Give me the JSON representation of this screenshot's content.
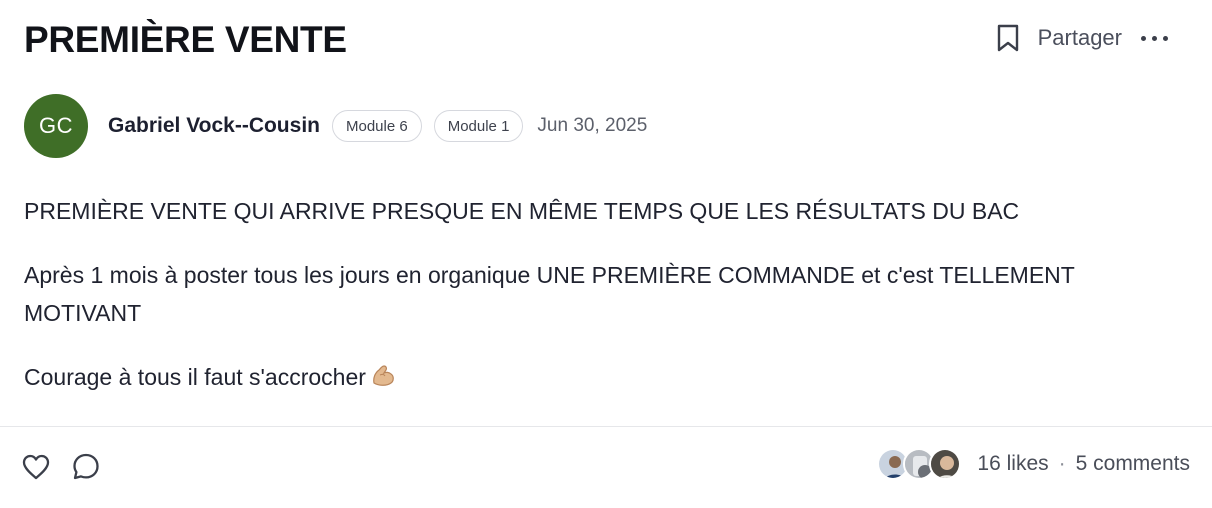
{
  "post": {
    "title": "PREMIÈRE VENTE",
    "share_label": "Partager",
    "author": {
      "initials": "GC",
      "name": "Gabriel Vock--Cousin",
      "avatar_color": "#3f6e27"
    },
    "tags": [
      "Module 6",
      "Module 1"
    ],
    "date": "Jun 30, 2025",
    "paragraphs": [
      "PREMIÈRE VENTE QUI ARRIVE PRESQUE EN MÊME TEMPS QUE LES RÉSULTATS DU BAC",
      "Après 1 mois à poster tous les jours en organique UNE PREMIÈRE COMMANDE et c'est TELLEMENT MOTIVANT",
      "Courage à tous il faut s'accrocher"
    ],
    "emoji": "flexed-biceps-icon",
    "likes_text": "16 likes",
    "separator": "·",
    "comments_text": "5 comments"
  },
  "icons": {
    "bookmark": "bookmark-icon",
    "more": "more-horizontal-icon",
    "like": "heart-icon",
    "comment": "comment-bubble-icon"
  }
}
